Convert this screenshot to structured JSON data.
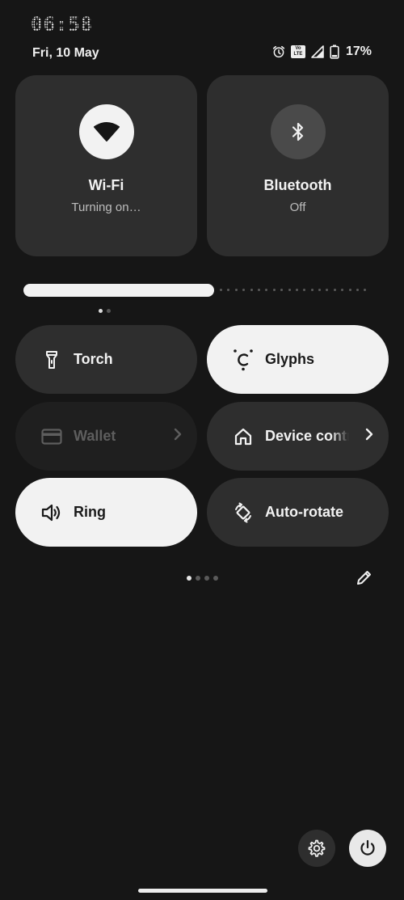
{
  "status": {
    "time": "06:58",
    "date": "Fri, 10 May",
    "volte_line1": "Vo",
    "volte_line2": "LTE",
    "battery_percent": "17%",
    "icons": [
      "alarm-icon",
      "volte-icon",
      "signal-icon",
      "battery-icon"
    ]
  },
  "big_tiles": {
    "wifi": {
      "title": "Wi-Fi",
      "subtitle": "Turning on…",
      "state": "active",
      "icon": "wifi-icon"
    },
    "bluetooth": {
      "title": "Bluetooth",
      "subtitle": "Off",
      "state": "off",
      "icon": "bluetooth-icon"
    }
  },
  "brightness": {
    "level": 0.51
  },
  "tiles": {
    "torch": {
      "label": "Torch",
      "state": "off",
      "icon": "torch-icon"
    },
    "glyphs": {
      "label": "Glyphs",
      "state": "on",
      "icon": "glyphs-icon"
    },
    "wallet": {
      "label": "Wallet",
      "state": "unavailable",
      "icon": "wallet-icon"
    },
    "device_controls": {
      "label": "Device controls",
      "state": "off",
      "icon": "home-icon"
    },
    "ring": {
      "label": "Ring",
      "state": "on",
      "icon": "speaker-icon"
    },
    "auto_rotate": {
      "label": "Auto-rotate",
      "state": "off",
      "icon": "rotate-icon"
    }
  },
  "pager": {
    "pages": 4,
    "current": 1
  },
  "colors": {
    "background": "#161616",
    "tile": "#2e2e2e",
    "tile_active": "#f2f2f2",
    "tile_disabled": "#1f1f1f"
  }
}
